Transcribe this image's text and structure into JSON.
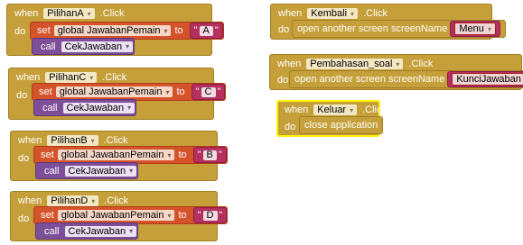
{
  "keywords": {
    "when": "when",
    "click": ".Click",
    "do": "do",
    "set": "set",
    "to": "to",
    "call": "call",
    "open_screen": "open another screen  screenName",
    "close_app": "close application"
  },
  "left_blocks": [
    {
      "component": "PilihanA",
      "variable": "global JawabanPemain",
      "value": "A",
      "procedure": "CekJawaban"
    },
    {
      "component": "PilihanC",
      "variable": "global JawabanPemain",
      "value": "C",
      "procedure": "CekJawaban"
    },
    {
      "component": "PilihanB",
      "variable": "global JawabanPemain",
      "value": "B",
      "procedure": "CekJawaban"
    },
    {
      "component": "PilihanD",
      "variable": "global JawabanPemain",
      "value": "D",
      "procedure": "CekJawaban"
    }
  ],
  "right_blocks": [
    {
      "component": "Kembali",
      "screen_name": "Menu"
    },
    {
      "component": "Pembahasan_soal",
      "screen_name": "KunciJawaban"
    },
    {
      "component": "Keluar"
    }
  ],
  "colors": {
    "event": "#c59f39",
    "set_variable": "#d5532a",
    "text": "#b3305f",
    "procedure_call": "#7d4f98",
    "selected_outline": "#fff200"
  },
  "icons": {
    "dropdown_caret": "▾"
  }
}
